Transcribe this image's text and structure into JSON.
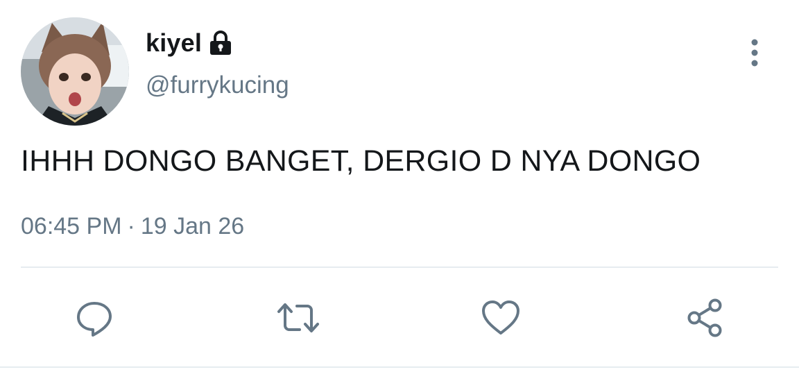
{
  "user": {
    "display_name": "kiyel",
    "handle": "@furrykucing",
    "protected_icon": "lock-icon"
  },
  "tweet": {
    "text": "IHHH DONGO BANGET, DERGIO D NYA DONGO",
    "time": "06:45 PM",
    "separator": "·",
    "date": "19 Jan 26"
  },
  "actions": [
    {
      "icon": "reply-icon"
    },
    {
      "icon": "retweet-icon"
    },
    {
      "icon": "like-icon"
    },
    {
      "icon": "share-icon"
    }
  ],
  "colors": {
    "text_primary": "#14171a",
    "text_secondary": "#657786",
    "icon": "#657786",
    "divider": "#e6ecf0"
  }
}
